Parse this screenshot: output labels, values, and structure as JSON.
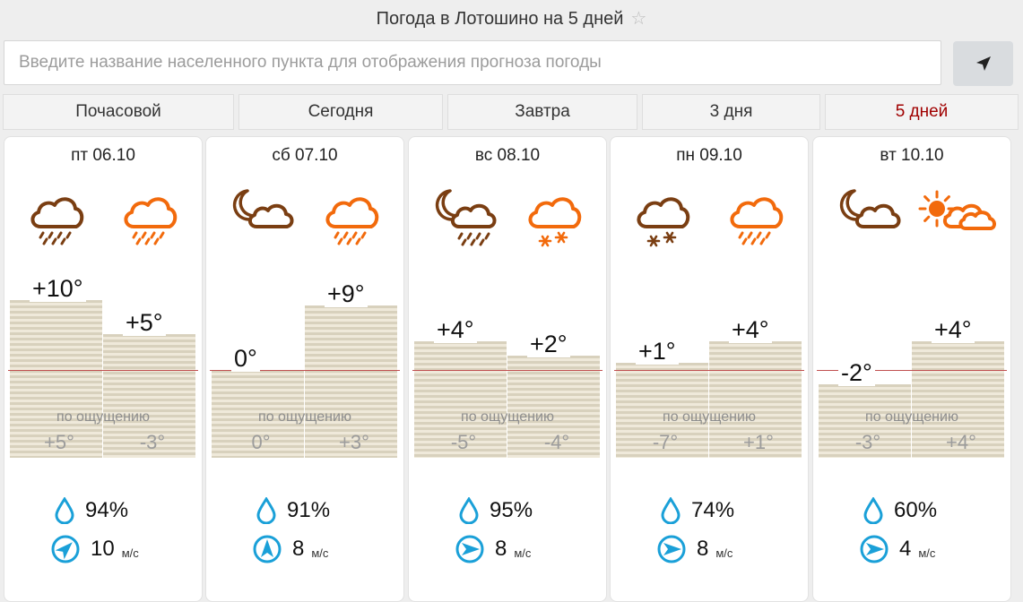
{
  "header": {
    "title": "Погода в Лотошино на 5 дней",
    "star_icon": "star-outline-icon"
  },
  "search": {
    "placeholder": "Введите название населенного пункта для отображения прогноза погоды",
    "value": "",
    "locate_icon": "location-arrow-icon"
  },
  "tabs": [
    {
      "label": "Почасовой",
      "active": false
    },
    {
      "label": "Сегодня",
      "active": false
    },
    {
      "label": "Завтра",
      "active": false
    },
    {
      "label": "3 дня",
      "active": false
    },
    {
      "label": "5 дней",
      "active": true
    }
  ],
  "colors": {
    "accent_active": "#a00000",
    "night_icon": "#7a3e12",
    "day_icon": "#f26a0c",
    "stat_icon": "#1aa0d8"
  },
  "days": [
    {
      "date": "пт 06.10",
      "night": {
        "icon": "cloud-rain-night-icon",
        "temp": "+10°",
        "value": 10,
        "feel": "+5°"
      },
      "day": {
        "icon": "cloud-rain-day-icon",
        "temp": "+5°",
        "value": 5,
        "feel": "-3°"
      },
      "feel_label": "по ощущению",
      "humidity": "94%",
      "wind": {
        "value": "10",
        "unit": "м/с",
        "direction_deg": 45
      }
    },
    {
      "date": "сб 07.10",
      "night": {
        "icon": "moon-cloud-icon",
        "temp": "0°",
        "value": 0,
        "feel": "0°"
      },
      "day": {
        "icon": "cloud-rain-day-icon",
        "temp": "+9°",
        "value": 9,
        "feel": "+3°"
      },
      "feel_label": "по ощущению",
      "humidity": "91%",
      "wind": {
        "value": "8",
        "unit": "м/с",
        "direction_deg": 0
      }
    },
    {
      "date": "вс 08.10",
      "night": {
        "icon": "moon-cloud-rain-icon",
        "temp": "+4°",
        "value": 4,
        "feel": "-5°"
      },
      "day": {
        "icon": "cloud-snow-day-icon",
        "temp": "+2°",
        "value": 2,
        "feel": "-4°"
      },
      "feel_label": "по ощущению",
      "humidity": "95%",
      "wind": {
        "value": "8",
        "unit": "м/с",
        "direction_deg": 90
      }
    },
    {
      "date": "пн 09.10",
      "night": {
        "icon": "cloud-snow-night-icon",
        "temp": "+1°",
        "value": 1,
        "feel": "-7°"
      },
      "day": {
        "icon": "cloud-rain-day-icon",
        "temp": "+4°",
        "value": 4,
        "feel": "+1°"
      },
      "feel_label": "по ощущению",
      "humidity": "74%",
      "wind": {
        "value": "8",
        "unit": "м/с",
        "direction_deg": 90
      }
    },
    {
      "date": "вт 10.10",
      "night": {
        "icon": "moon-cloud-icon",
        "temp": "-2°",
        "value": -2,
        "feel": "-3°"
      },
      "day": {
        "icon": "sun-cloud-icon",
        "temp": "+4°",
        "value": 4,
        "feel": "+4°"
      },
      "feel_label": "по ощущению",
      "humidity": "60%",
      "wind": {
        "value": "4",
        "unit": "м/с",
        "direction_deg": 90
      }
    }
  ]
}
